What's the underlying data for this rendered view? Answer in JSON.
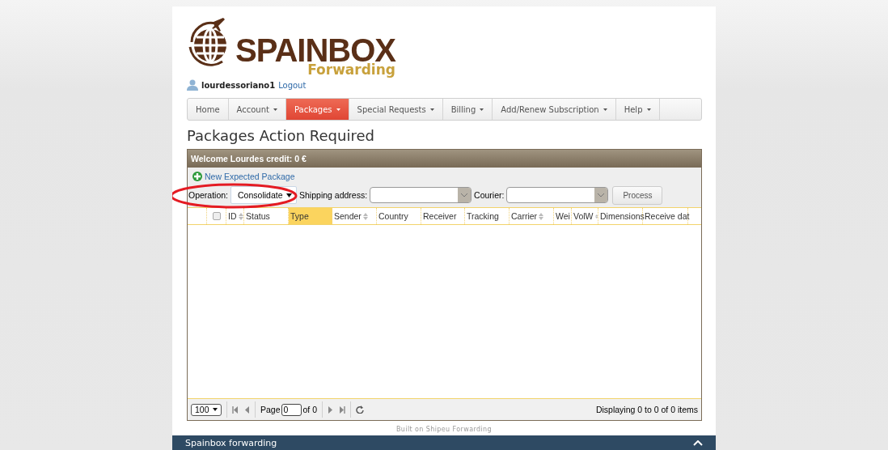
{
  "logo": {
    "name": "SPAINBOX",
    "tagline": "Forwarding"
  },
  "user": {
    "username": "lourdessoriano1",
    "logout": "Logout"
  },
  "nav": [
    {
      "label": "Home",
      "dropdown": false,
      "selected": false
    },
    {
      "label": "Account",
      "dropdown": true,
      "selected": false
    },
    {
      "label": "Packages",
      "dropdown": true,
      "selected": true
    },
    {
      "label": "Special Requests",
      "dropdown": true,
      "selected": false
    },
    {
      "label": "Billing",
      "dropdown": true,
      "selected": false
    },
    {
      "label": "Add/Renew Subscription",
      "dropdown": true,
      "selected": false
    },
    {
      "label": "Help",
      "dropdown": true,
      "selected": false
    }
  ],
  "page_title": "Packages Action Required",
  "panel": {
    "title": "Welcome Lourdes credit: 0 €",
    "new_link": "New Expected Package",
    "operation": {
      "label": "Operation:",
      "value": "Consolidate"
    },
    "shipping": {
      "label": "Shipping address:"
    },
    "courier": {
      "label": "Courier:"
    },
    "process": "Process",
    "select_all": {
      "checked": false
    },
    "columns": [
      {
        "label": "ID",
        "sortable": true,
        "selected": false
      },
      {
        "label": "Status",
        "sortable": false,
        "selected": false
      },
      {
        "label": "Type",
        "sortable": false,
        "selected": true
      },
      {
        "label": "Sender",
        "sortable": true,
        "selected": false
      },
      {
        "label": "Country",
        "sortable": false,
        "selected": false
      },
      {
        "label": "Receiver",
        "sortable": false,
        "selected": false
      },
      {
        "label": "Tracking",
        "sortable": false,
        "selected": false
      },
      {
        "label": "Carrier",
        "sortable": true,
        "selected": false
      },
      {
        "label": "Wei",
        "sortable": false,
        "selected": false
      },
      {
        "label": "VolW",
        "sortable": true,
        "selected": false
      },
      {
        "label": "Dimensions",
        "sortable": false,
        "selected": false
      },
      {
        "label": "Receive dat",
        "sortable": false,
        "selected": false
      }
    ],
    "pager": {
      "page_size": "100",
      "page_label": "Page",
      "page": "0",
      "of": "of 0",
      "display": "Displaying 0 to 0 of 0 items"
    }
  },
  "annotation": {
    "kind": "ellipse"
  },
  "credit": "Built on Shipeu Forwarding",
  "footer": {
    "title": "Spainbox forwarding"
  }
}
